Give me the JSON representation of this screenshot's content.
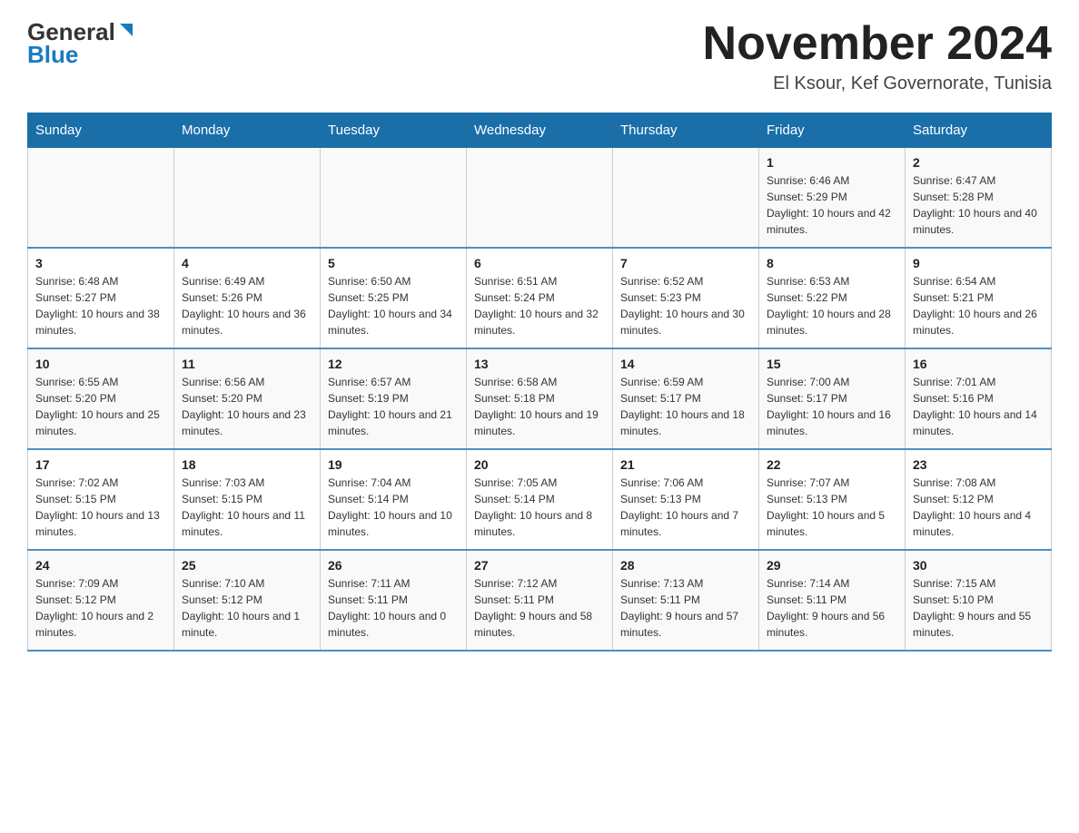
{
  "header": {
    "logo_general": "General",
    "logo_blue": "Blue",
    "month_title": "November 2024",
    "location": "El Ksour, Kef Governorate, Tunisia"
  },
  "weekdays": [
    "Sunday",
    "Monday",
    "Tuesday",
    "Wednesday",
    "Thursday",
    "Friday",
    "Saturday"
  ],
  "weeks": [
    [
      {
        "day": "",
        "info": ""
      },
      {
        "day": "",
        "info": ""
      },
      {
        "day": "",
        "info": ""
      },
      {
        "day": "",
        "info": ""
      },
      {
        "day": "",
        "info": ""
      },
      {
        "day": "1",
        "info": "Sunrise: 6:46 AM\nSunset: 5:29 PM\nDaylight: 10 hours and 42 minutes."
      },
      {
        "day": "2",
        "info": "Sunrise: 6:47 AM\nSunset: 5:28 PM\nDaylight: 10 hours and 40 minutes."
      }
    ],
    [
      {
        "day": "3",
        "info": "Sunrise: 6:48 AM\nSunset: 5:27 PM\nDaylight: 10 hours and 38 minutes."
      },
      {
        "day": "4",
        "info": "Sunrise: 6:49 AM\nSunset: 5:26 PM\nDaylight: 10 hours and 36 minutes."
      },
      {
        "day": "5",
        "info": "Sunrise: 6:50 AM\nSunset: 5:25 PM\nDaylight: 10 hours and 34 minutes."
      },
      {
        "day": "6",
        "info": "Sunrise: 6:51 AM\nSunset: 5:24 PM\nDaylight: 10 hours and 32 minutes."
      },
      {
        "day": "7",
        "info": "Sunrise: 6:52 AM\nSunset: 5:23 PM\nDaylight: 10 hours and 30 minutes."
      },
      {
        "day": "8",
        "info": "Sunrise: 6:53 AM\nSunset: 5:22 PM\nDaylight: 10 hours and 28 minutes."
      },
      {
        "day": "9",
        "info": "Sunrise: 6:54 AM\nSunset: 5:21 PM\nDaylight: 10 hours and 26 minutes."
      }
    ],
    [
      {
        "day": "10",
        "info": "Sunrise: 6:55 AM\nSunset: 5:20 PM\nDaylight: 10 hours and 25 minutes."
      },
      {
        "day": "11",
        "info": "Sunrise: 6:56 AM\nSunset: 5:20 PM\nDaylight: 10 hours and 23 minutes."
      },
      {
        "day": "12",
        "info": "Sunrise: 6:57 AM\nSunset: 5:19 PM\nDaylight: 10 hours and 21 minutes."
      },
      {
        "day": "13",
        "info": "Sunrise: 6:58 AM\nSunset: 5:18 PM\nDaylight: 10 hours and 19 minutes."
      },
      {
        "day": "14",
        "info": "Sunrise: 6:59 AM\nSunset: 5:17 PM\nDaylight: 10 hours and 18 minutes."
      },
      {
        "day": "15",
        "info": "Sunrise: 7:00 AM\nSunset: 5:17 PM\nDaylight: 10 hours and 16 minutes."
      },
      {
        "day": "16",
        "info": "Sunrise: 7:01 AM\nSunset: 5:16 PM\nDaylight: 10 hours and 14 minutes."
      }
    ],
    [
      {
        "day": "17",
        "info": "Sunrise: 7:02 AM\nSunset: 5:15 PM\nDaylight: 10 hours and 13 minutes."
      },
      {
        "day": "18",
        "info": "Sunrise: 7:03 AM\nSunset: 5:15 PM\nDaylight: 10 hours and 11 minutes."
      },
      {
        "day": "19",
        "info": "Sunrise: 7:04 AM\nSunset: 5:14 PM\nDaylight: 10 hours and 10 minutes."
      },
      {
        "day": "20",
        "info": "Sunrise: 7:05 AM\nSunset: 5:14 PM\nDaylight: 10 hours and 8 minutes."
      },
      {
        "day": "21",
        "info": "Sunrise: 7:06 AM\nSunset: 5:13 PM\nDaylight: 10 hours and 7 minutes."
      },
      {
        "day": "22",
        "info": "Sunrise: 7:07 AM\nSunset: 5:13 PM\nDaylight: 10 hours and 5 minutes."
      },
      {
        "day": "23",
        "info": "Sunrise: 7:08 AM\nSunset: 5:12 PM\nDaylight: 10 hours and 4 minutes."
      }
    ],
    [
      {
        "day": "24",
        "info": "Sunrise: 7:09 AM\nSunset: 5:12 PM\nDaylight: 10 hours and 2 minutes."
      },
      {
        "day": "25",
        "info": "Sunrise: 7:10 AM\nSunset: 5:12 PM\nDaylight: 10 hours and 1 minute."
      },
      {
        "day": "26",
        "info": "Sunrise: 7:11 AM\nSunset: 5:11 PM\nDaylight: 10 hours and 0 minutes."
      },
      {
        "day": "27",
        "info": "Sunrise: 7:12 AM\nSunset: 5:11 PM\nDaylight: 9 hours and 58 minutes."
      },
      {
        "day": "28",
        "info": "Sunrise: 7:13 AM\nSunset: 5:11 PM\nDaylight: 9 hours and 57 minutes."
      },
      {
        "day": "29",
        "info": "Sunrise: 7:14 AM\nSunset: 5:11 PM\nDaylight: 9 hours and 56 minutes."
      },
      {
        "day": "30",
        "info": "Sunrise: 7:15 AM\nSunset: 5:10 PM\nDaylight: 9 hours and 55 minutes."
      }
    ]
  ]
}
